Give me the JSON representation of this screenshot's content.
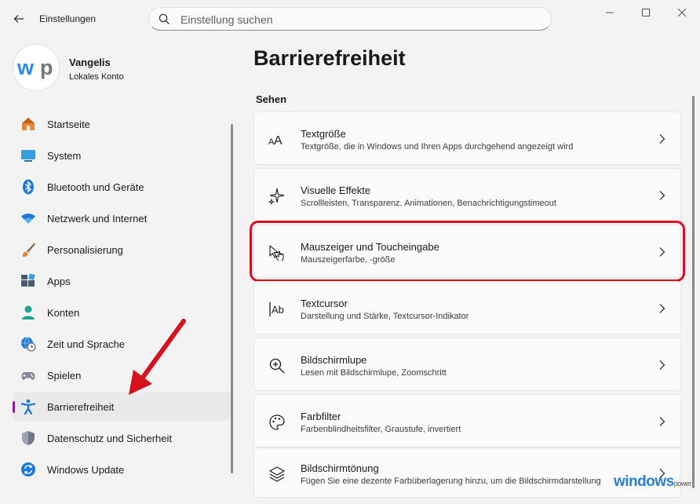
{
  "window": {
    "title": "Einstellungen",
    "controls": {
      "minimize": "minimize-icon",
      "maximize": "maximize-icon",
      "close": "close-icon"
    }
  },
  "search": {
    "placeholder": "Einstellung suchen",
    "value": ""
  },
  "profile": {
    "name": "Vangelis",
    "account_type": "Lokales Konto",
    "avatar_text": "wp"
  },
  "sidebar": {
    "items": [
      {
        "label": "Startseite",
        "icon": "home-icon",
        "active": false
      },
      {
        "label": "System",
        "icon": "monitor-icon",
        "active": false
      },
      {
        "label": "Bluetooth und Geräte",
        "icon": "bluetooth-icon",
        "active": false
      },
      {
        "label": "Netzwerk und Internet",
        "icon": "wifi-icon",
        "active": false
      },
      {
        "label": "Personalisierung",
        "icon": "brush-icon",
        "active": false
      },
      {
        "label": "Apps",
        "icon": "apps-icon",
        "active": false
      },
      {
        "label": "Konten",
        "icon": "person-icon",
        "active": false
      },
      {
        "label": "Zeit und Sprache",
        "icon": "globe-clock-icon",
        "active": false
      },
      {
        "label": "Spielen",
        "icon": "gamepad-icon",
        "active": false
      },
      {
        "label": "Barrierefreiheit",
        "icon": "accessibility-icon",
        "active": true
      },
      {
        "label": "Datenschutz und Sicherheit",
        "icon": "shield-icon",
        "active": false
      },
      {
        "label": "Windows Update",
        "icon": "update-icon",
        "active": false
      }
    ]
  },
  "main": {
    "page_title": "Barrierefreiheit",
    "section_title": "Sehen",
    "cards": [
      {
        "title": "Textgröße",
        "subtitle": "Textgröße, die in Windows und Ihren Apps durchgehend angezeigt wird",
        "icon": "text-size-icon"
      },
      {
        "title": "Visuelle Effekte",
        "subtitle": "Scrollleisten, Transparenz, Animationen, Benachrichtigungstimeout",
        "icon": "sparkle-icon"
      },
      {
        "title": "Mauszeiger und Toucheingabe",
        "subtitle": "Mauszeigerfarbe, -größe",
        "icon": "pointer-touch-icon",
        "highlighted": true
      },
      {
        "title": "Textcursor",
        "subtitle": "Darstellung und Stärke, Textcursor-Indikator",
        "icon": "text-cursor-icon"
      },
      {
        "title": "Bildschirmlupe",
        "subtitle": "Lesen mit Bildschirmlupe, Zoomschritt",
        "icon": "magnifier-icon"
      },
      {
        "title": "Farbfilter",
        "subtitle": "Farbenblindheitsfilter, Graustufe, invertiert",
        "icon": "palette-icon"
      },
      {
        "title": "Bildschirmtönung",
        "subtitle": "Fügen Sie eine dezente Farbüberlagerung hinzu, um die Bildschirmdarstellung",
        "icon": "layers-icon"
      }
    ]
  },
  "watermark": {
    "text": "windows",
    "suffix": "power"
  },
  "colors": {
    "accent": "#0067c0",
    "annotation": "#d8111e",
    "active_pill": "#8a1d8f",
    "background": "#f3f3f3"
  }
}
